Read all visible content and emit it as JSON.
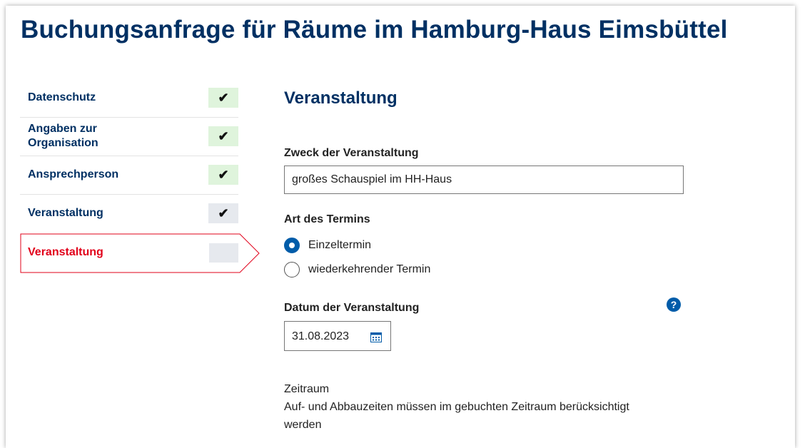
{
  "header": {
    "title": "Buchungsanfrage für Räume im Hamburg-Haus Eimsbüttel"
  },
  "sidebar": {
    "steps": [
      {
        "line1": "Datenschutz",
        "line2": "",
        "mark": "✔",
        "state": "done"
      },
      {
        "line1": "Angaben zur",
        "line2": "Organisation",
        "mark": "✔",
        "state": "done"
      },
      {
        "line1": "Ansprechperson",
        "line2": "",
        "mark": "✔",
        "state": "done"
      },
      {
        "line1": "Veranstaltung",
        "line2": "",
        "mark": "✔",
        "state": "visited"
      }
    ],
    "current": {
      "label": "Veranstaltung"
    }
  },
  "main": {
    "section_title": "Veranstaltung",
    "purpose": {
      "label": "Zweck der Veranstaltung",
      "value": "großes Schauspiel im HH-Haus"
    },
    "appointment_type": {
      "label": "Art des Termins",
      "options": [
        {
          "label": "Einzeltermin",
          "selected": true
        },
        {
          "label": "wiederkehrender Termin",
          "selected": false
        }
      ]
    },
    "date": {
      "label": "Datum der Veranstaltung",
      "value": "31.08.2023",
      "help": "?"
    },
    "period": {
      "heading": "Zeitraum",
      "note_line1": "Auf- und Abbauzeiten müssen im gebuchten Zeitraum berücksichtigt",
      "note_line2": "werden"
    }
  },
  "colors": {
    "brand": "#003063",
    "accent": "#005ca9",
    "error": "#e1001a",
    "done_bg": "#dff4dc",
    "visited_bg": "#e6e9ee"
  },
  "icons": [
    "check-icon",
    "arrow-step-indicator",
    "help-icon",
    "calendar-icon"
  ]
}
